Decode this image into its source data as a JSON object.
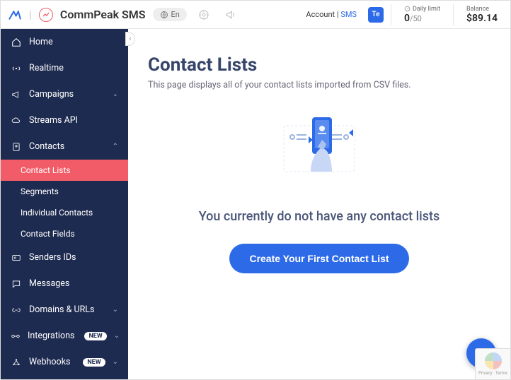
{
  "header": {
    "brand": "CommPeak SMS",
    "lang": "En",
    "account_label": "Account",
    "account_link": "SMS",
    "avatar": "Te",
    "daily_limit_label": "Daily limit",
    "daily_limit_used": "0",
    "daily_limit_total": "/50",
    "balance_label": "Balance",
    "balance_value": "$89.14"
  },
  "sidebar": {
    "home": "Home",
    "realtime": "Realtime",
    "campaigns": "Campaigns",
    "streams": "Streams API",
    "contacts": "Contacts",
    "contacts_sub": {
      "lists": "Contact Lists",
      "segments": "Segments",
      "individual": "Individual Contacts",
      "fields": "Contact Fields"
    },
    "senders": "Senders IDs",
    "messages": "Messages",
    "domains": "Domains & URLs",
    "integrations": "Integrations",
    "webhooks": "Webhooks",
    "badge_new": "NEW"
  },
  "main": {
    "title": "Contact Lists",
    "description": "This page displays all of your contact lists imported from CSV files.",
    "empty_message": "You currently do not have any contact lists",
    "cta": "Create Your First Contact List"
  },
  "footer": {
    "recaptcha": "Privacy · Terms"
  }
}
